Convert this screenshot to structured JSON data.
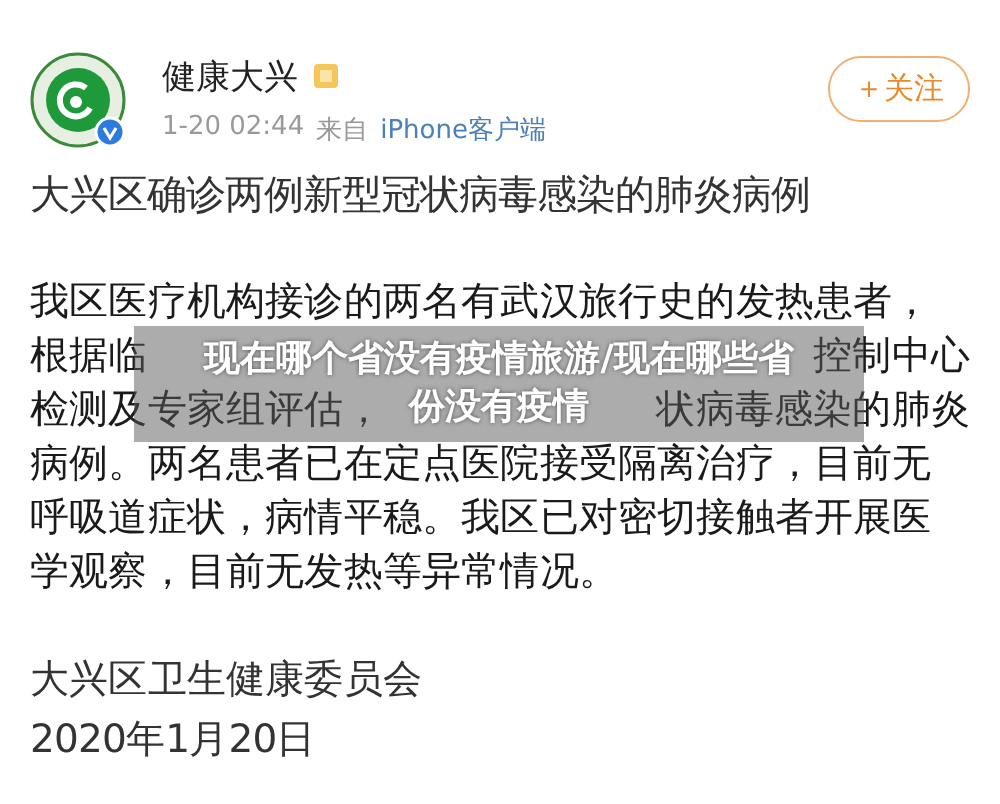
{
  "post": {
    "author": "健康大兴",
    "time": "1-20 02:44",
    "source_prefix": "来自",
    "source": "iPhone客户端",
    "follow_label": "＋关注",
    "title": "大兴区确诊两例新型冠状病毒感染的肺炎病例",
    "body_lines": [
      {
        "left": "我区医疗机构接诊的两名有武汉旅行史的发热患者，"
      },
      {
        "left": "根据临",
        "right": "控制中心"
      },
      {
        "left": "检测及专家组评估，",
        "right": "状病毒感染的肺炎"
      },
      {
        "left": "病例。两名患者已在定点医院接受隔离治疗，目前无"
      },
      {
        "left": "呼吸道症状，病情平稳。我区已对密切接触者开展医"
      },
      {
        "left": "学观察，目前无发热等异常情况。"
      }
    ],
    "signature": [
      "大兴区卫生健康委员会",
      "2020年1月20日"
    ]
  },
  "overlay_caption": "现在哪个省没有疫情旅游/现在哪些省份没有疫情"
}
